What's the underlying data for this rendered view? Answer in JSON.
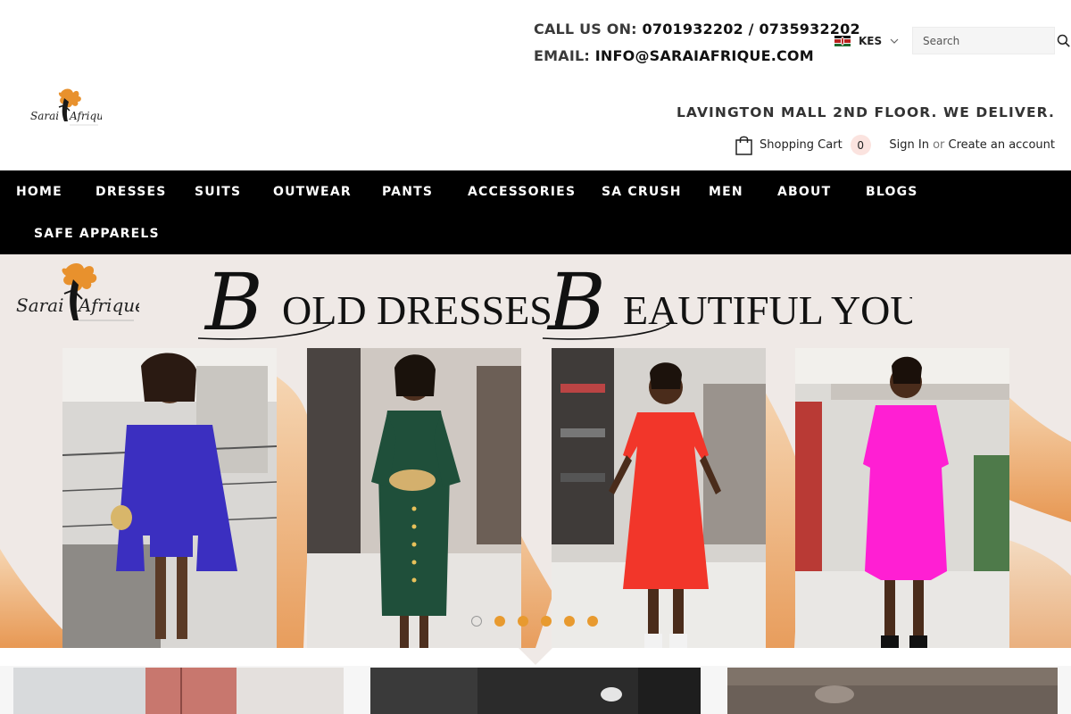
{
  "header": {
    "call_label": "CALL US ON:",
    "call_value": "0701932202 / 0735932202",
    "email_label": "EMAIL:",
    "email_value": "INFO@SARAIAFRIQUE.COM",
    "currency": "KES",
    "currency_flag_icon": "kenya-flag-icon",
    "search_placeholder": "Search",
    "address": "LAVINGTON MALL 2ND FLOOR. WE DELIVER.",
    "cart_label": "Shopping Cart",
    "cart_count": "0",
    "sign_in": "Sign In",
    "or": "or",
    "create_account": "Create an account",
    "brand_logo_text": "SaraiAfrique"
  },
  "nav": {
    "items": [
      {
        "label": "HOME"
      },
      {
        "label": "DRESSES"
      },
      {
        "label": "SUITS"
      },
      {
        "label": "OUTWEAR"
      },
      {
        "label": "PANTS"
      },
      {
        "label": "ACCESSORIES"
      },
      {
        "label": "SA CRUSH"
      },
      {
        "label": "MEN"
      },
      {
        "label": "ABOUT"
      },
      {
        "label": "BLOGS"
      },
      {
        "label": "SAFE APPARELS"
      }
    ]
  },
  "hero": {
    "headline_part1_initial": "B",
    "headline_part1_rest": "OLD DRESSES.",
    "headline_part2_initial": "B",
    "headline_part2_rest": "EAUTIFUL YOU.",
    "slide_count": 6,
    "active_slide": 1,
    "dress_colors": [
      "#3b2fc0",
      "#1f4f3a",
      "#f2362a",
      "#ff1fd3"
    ],
    "accent_color": "#e89a2f"
  }
}
